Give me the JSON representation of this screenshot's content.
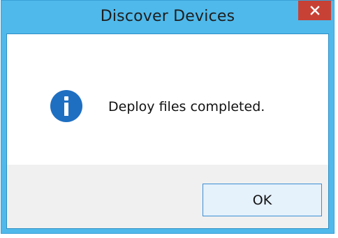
{
  "window": {
    "title": "Discover Devices"
  },
  "dialog": {
    "message": "Deploy files completed.",
    "ok_label": "OK"
  },
  "icons": {
    "close": "close-icon",
    "info": "info-icon"
  },
  "colors": {
    "frame": "#4fb9eb",
    "close_button": "#c84135",
    "info_icon": "#1e6fc2",
    "footer": "#f0f0f0",
    "ok_button_fill": "#e5f1fb",
    "ok_button_border": "#3c8fd4"
  }
}
